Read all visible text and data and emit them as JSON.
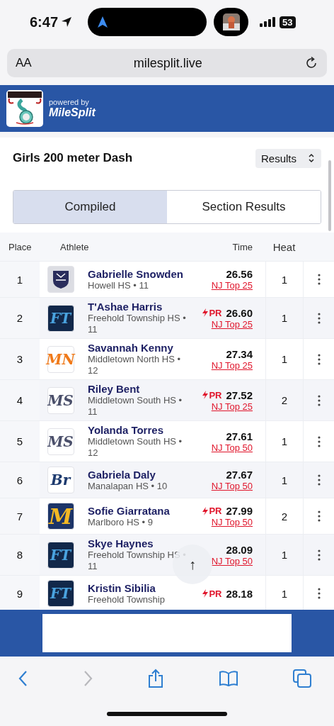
{
  "status_bar": {
    "time": "6:47",
    "battery": "53"
  },
  "browser": {
    "text_size_button": "AA",
    "url": "milesplit.live"
  },
  "site_header": {
    "powered_by": "powered by",
    "brand": "MileSplit"
  },
  "event": {
    "title": "Girls 200 meter Dash",
    "view_select": "Results"
  },
  "tabs": [
    {
      "label": "Compiled",
      "selected": true
    },
    {
      "label": "Section Results",
      "selected": false
    }
  ],
  "table": {
    "columns": [
      "Place",
      "Athlete",
      "Time",
      "Heat"
    ],
    "rows": [
      {
        "place": "1",
        "name": "Gabrielle Snowden",
        "school": "Howell HS • 11",
        "time": "26.56",
        "rank": "NJ Top 25",
        "heat": "1",
        "logo": {
          "kind": "shield"
        }
      },
      {
        "place": "2",
        "name": "T'Ashae Harris",
        "school": "Freehold Township HS • 11",
        "badge": "PR",
        "time": "26.60",
        "rank": "NJ Top 25",
        "heat": "1",
        "logo": {
          "kind": "navy",
          "text": "FT"
        }
      },
      {
        "place": "3",
        "name": "Savannah Kenny",
        "school": "Middletown North HS • 12",
        "time": "27.34",
        "rank": "NJ Top 25",
        "heat": "1",
        "logo": {
          "kind": "orange",
          "text": "MN"
        }
      },
      {
        "place": "4",
        "name": "Riley Bent",
        "school": "Middletown South HS • 11",
        "badge": "PR",
        "time": "27.52",
        "rank": "NJ Top 25",
        "heat": "2",
        "logo": {
          "kind": "grey",
          "text": "MS"
        }
      },
      {
        "place": "5",
        "name": "Yolanda Torres",
        "school": "Middletown South HS • 12",
        "time": "27.61",
        "rank": "NJ Top 50",
        "heat": "1",
        "logo": {
          "kind": "grey",
          "text": "MS"
        }
      },
      {
        "place": "6",
        "name": "Gabriela Daly",
        "school": "Manalapan HS • 10",
        "time": "27.67",
        "rank": "NJ Top 50",
        "heat": "1",
        "logo": {
          "kind": "wing",
          "text": "Br"
        }
      },
      {
        "place": "7",
        "name": "Sofie Giarratana",
        "school": "Marlboro HS • 9",
        "badge": "PR",
        "time": "27.99",
        "rank": "NJ Top 50",
        "heat": "2",
        "logo": {
          "kind": "gold",
          "text": "M"
        }
      },
      {
        "place": "8",
        "name": "Skye Haynes",
        "school": "Freehold Township HS • 11",
        "time": "28.09",
        "rank": "NJ Top 50",
        "heat": "1",
        "logo": {
          "kind": "navy",
          "text": "FT"
        }
      },
      {
        "place": "9",
        "name": "Kristin Sibilia",
        "school": "Freehold Township",
        "badge": "PR",
        "time": "28.18",
        "heat": "1",
        "logo": {
          "kind": "navy",
          "text": "FT"
        }
      }
    ]
  },
  "scroll_top_button": "↑"
}
